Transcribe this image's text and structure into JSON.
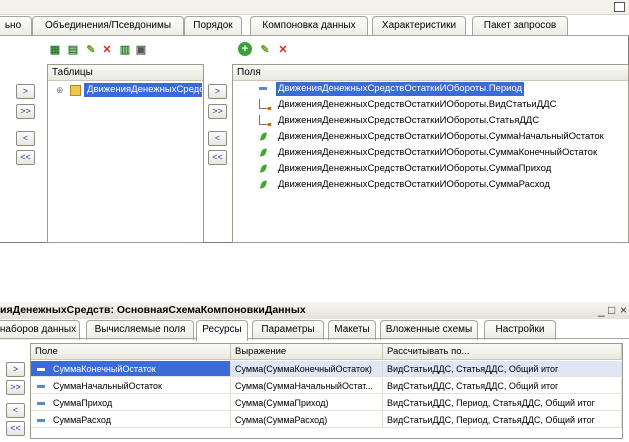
{
  "top_panel": {
    "tabs": [
      {
        "label": "ьно"
      },
      {
        "label": "Объединения/Псевдонимы"
      },
      {
        "label": "Порядок"
      },
      {
        "label": "Компоновка данных"
      },
      {
        "label": "Характеристики"
      },
      {
        "label": "Пакет запросов"
      }
    ],
    "tables_header": "Таблицы",
    "table_item": "ДвиженияДенежныхСредств",
    "fields_header": "Поля",
    "fields": [
      {
        "icon": "dimension-icon",
        "text": "ДвиженияДенежныхСредствОстаткиИОбороты.Период",
        "selected": true
      },
      {
        "icon": "reference-icon",
        "text": "ДвиженияДенежныхСредствОстаткиИОбороты.ВидСтатьиДДС"
      },
      {
        "icon": "reference-icon",
        "text": "ДвиженияДенежныхСредствОстаткиИОбороты.СтатьяДДС"
      },
      {
        "icon": "resource-icon",
        "text": "ДвиженияДенежныхСредствОстаткиИОбороты.СуммаНачальныйОстаток"
      },
      {
        "icon": "resource-icon",
        "text": "ДвиженияДенежныхСредствОстаткиИОбороты.СуммаКонечныйОстаток"
      },
      {
        "icon": "resource-icon",
        "text": "ДвиженияДенежныхСредствОстаткиИОбороты.СуммаПриход"
      },
      {
        "icon": "resource-icon",
        "text": "ДвиженияДенежныхСредствОстаткиИОбороты.СуммаРасход"
      }
    ],
    "move_buttons": [
      ">",
      ">>",
      "<",
      "<<"
    ]
  },
  "bottom_panel": {
    "title": "ияДенежныхСредств: ОсновнаяСхемаКомпоновкиДанных",
    "window_controls": {
      "minimize": "_",
      "maximize": "□",
      "close": "×"
    },
    "tabs": [
      {
        "label": "наборов данных"
      },
      {
        "label": "Вычисляемые поля"
      },
      {
        "label": "Ресурсы",
        "active": true
      },
      {
        "label": "Параметры"
      },
      {
        "label": "Макеты"
      },
      {
        "label": "Вложенные схемы"
      },
      {
        "label": "Настройки"
      }
    ],
    "columns": [
      "Поле",
      "Выражение",
      "Рассчитывать по..."
    ],
    "rows": [
      {
        "field": "СуммаКонечныйОстаток",
        "expression": "Сумма(СуммаКонечныйОстаток)",
        "calc_by": "ВидСтатьиДДС, СтатьяДДС, Общий итог",
        "selected": true
      },
      {
        "field": "СуммаНачальныйОстаток",
        "expression": "Сумма(СуммаНачальныйОстат...",
        "calc_by": "ВидСтатьиДДС, СтатьяДДС, Общий итог"
      },
      {
        "field": "СуммаПриход",
        "expression": "Сумма(СуммаПриход)",
        "calc_by": "ВидСтатьиДДС, Период, СтатьяДДС, Общий итог"
      },
      {
        "field": "СуммаРасход",
        "expression": "Сумма(СуммаРасход)",
        "calc_by": "ВидСтатьиДДС, Период, СтатьяДДС, Общий итог"
      }
    ],
    "move_buttons": [
      ">",
      ">>",
      "<",
      "<<"
    ]
  },
  "colors": {
    "selection": "#3a6bd6",
    "accent_green": "#4ca82a",
    "delete_red": "#d52a1e"
  }
}
